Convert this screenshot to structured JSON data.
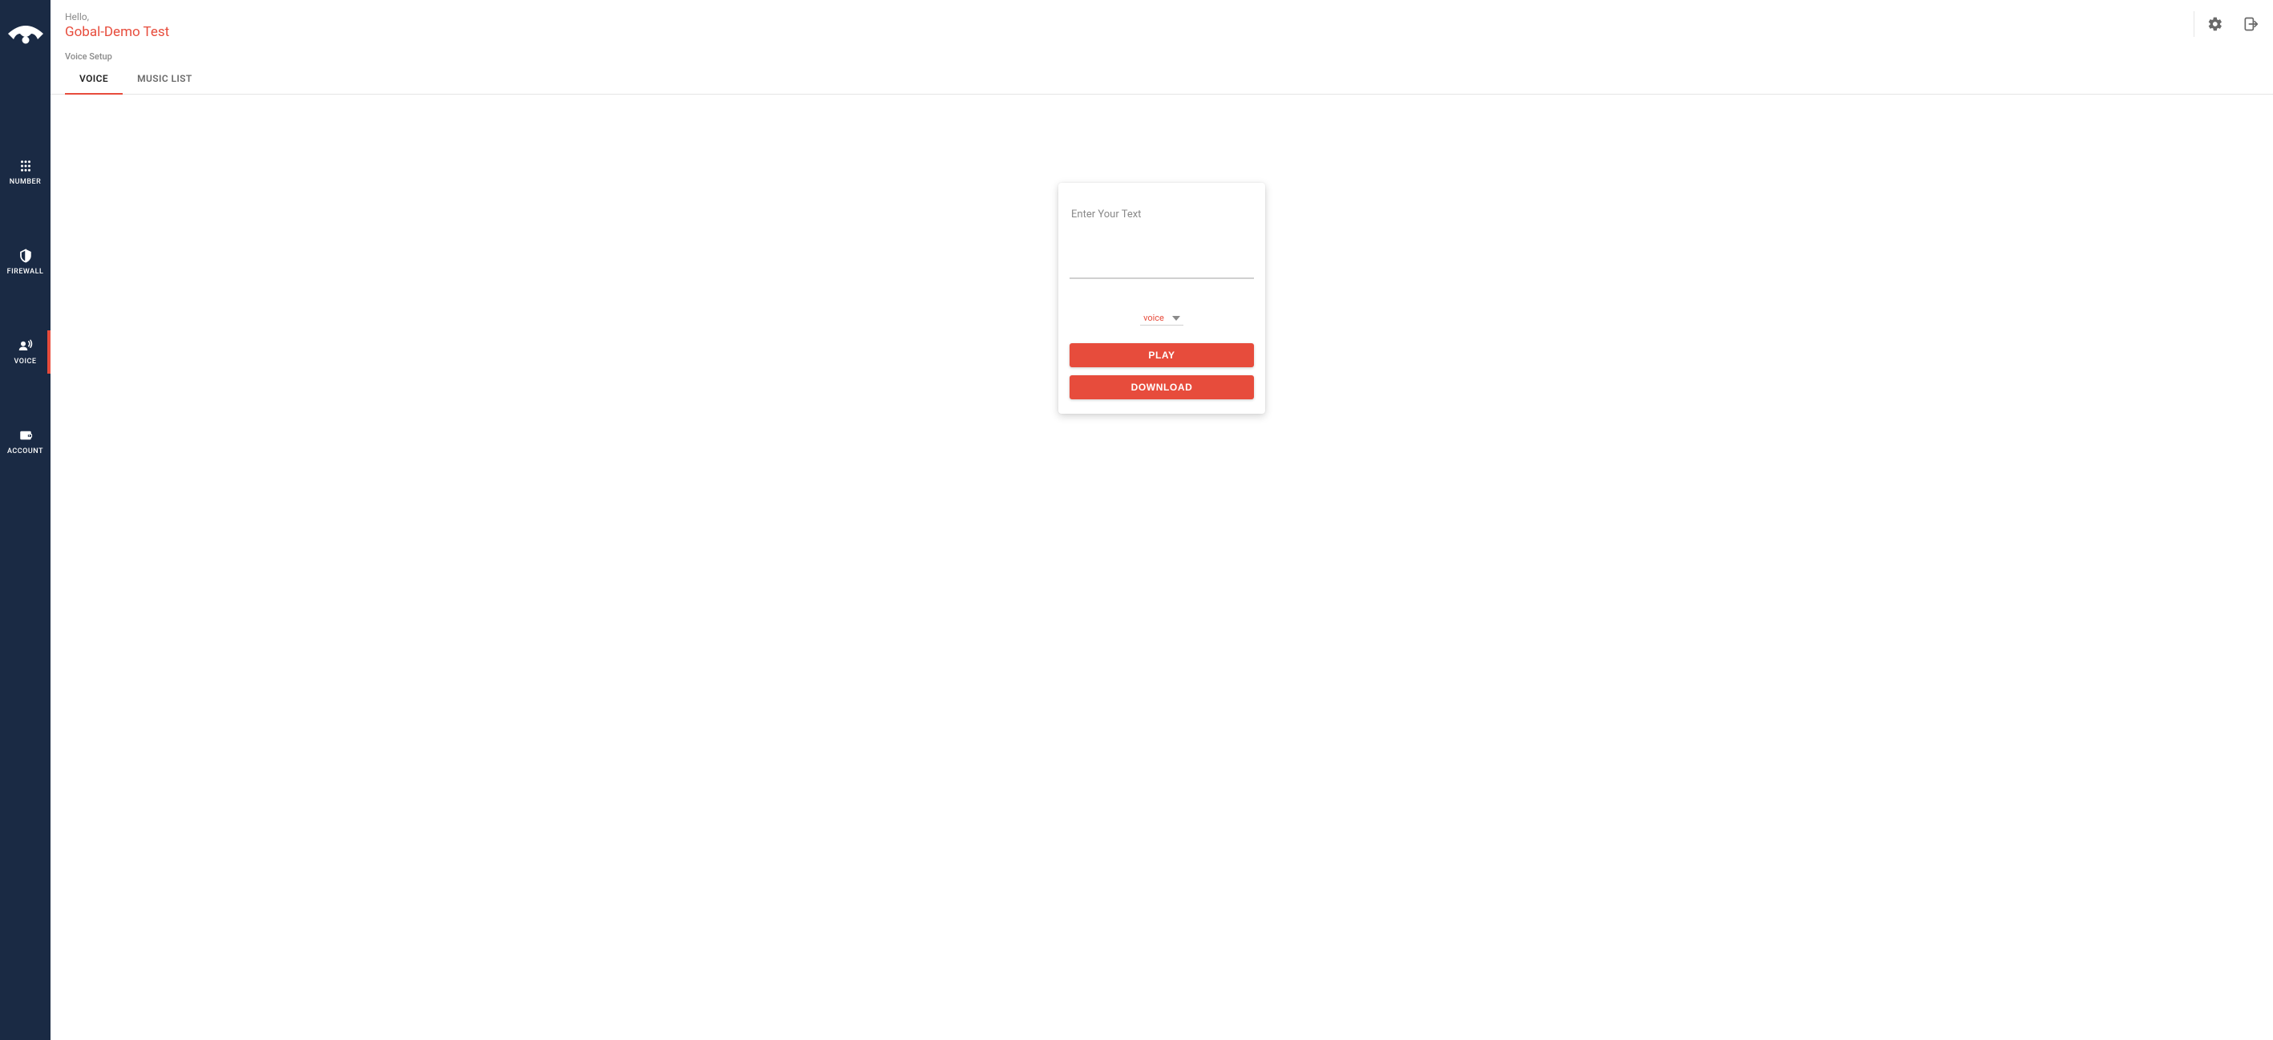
{
  "header": {
    "hello": "Hello,",
    "account_name": "Gobal-Demo Test"
  },
  "section_title": "Voice Setup",
  "tabs": [
    {
      "id": "voice",
      "label": "VOICE",
      "active": true
    },
    {
      "id": "music",
      "label": "MUSIC LIST",
      "active": false
    }
  ],
  "sidebar": {
    "items": [
      {
        "id": "number",
        "label": "NUMBER",
        "icon": "dialpad-icon",
        "active": false
      },
      {
        "id": "firewall",
        "label": "FIREWALL",
        "icon": "shield-icon",
        "active": false
      },
      {
        "id": "voice",
        "label": "VOICE",
        "icon": "record-voice-icon",
        "active": true
      },
      {
        "id": "account",
        "label": "ACCOUNT",
        "icon": "wallet-icon",
        "active": false
      }
    ]
  },
  "card": {
    "text_placeholder": "Enter Your Text",
    "text_value": "",
    "select_label": "voice",
    "play_label": "PLAY",
    "download_label": "DOWNLOAD"
  },
  "colors": {
    "accent": "#e74c3c",
    "sidebar_bg": "#1a2a44"
  }
}
